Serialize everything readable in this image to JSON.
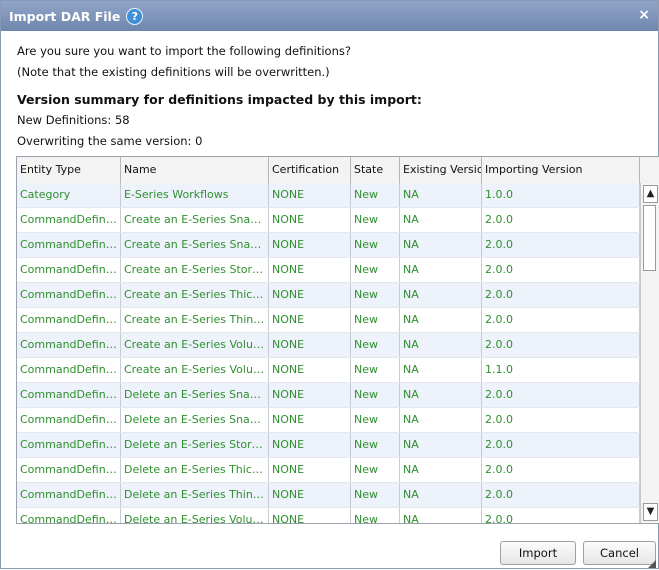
{
  "window": {
    "title": "Import DAR File"
  },
  "prompt": {
    "question": "Are you sure you want to import the following definitions?",
    "note": "(Note that the existing definitions will be overwritten.)",
    "summary_heading": "Version summary for definitions impacted by this import:",
    "new_definitions": "New Definitions: 58",
    "overwriting": "Overwriting the same version: 0"
  },
  "table": {
    "columns": [
      "Entity Type",
      "Name",
      "Certification",
      "State",
      "Existing Version",
      "Importing Version"
    ],
    "rows": [
      [
        "Category",
        "E-Series Workflows",
        "NONE",
        "New",
        "NA",
        "1.0.0"
      ],
      [
        "CommandDefinition",
        "Create an E-Series Snapshot",
        "NONE",
        "New",
        "NA",
        "2.0.0"
      ],
      [
        "CommandDefinition",
        "Create an E-Series Snaps...",
        "NONE",
        "New",
        "NA",
        "2.0.0"
      ],
      [
        "CommandDefinition",
        "Create an E-Series Storag...",
        "NONE",
        "New",
        "NA",
        "2.0.0"
      ],
      [
        "CommandDefinition",
        "Create an E-Series Thick V...",
        "NONE",
        "New",
        "NA",
        "2.0.0"
      ],
      [
        "CommandDefinition",
        "Create an E-Series Thin V...",
        "NONE",
        "New",
        "NA",
        "2.0.0"
      ],
      [
        "CommandDefinition",
        "Create an E-Series Volume...",
        "NONE",
        "New",
        "NA",
        "2.0.0"
      ],
      [
        "CommandDefinition",
        "Create an E-Series Volume...",
        "NONE",
        "New",
        "NA",
        "1.1.0"
      ],
      [
        "CommandDefinition",
        "Delete an E-Series Snapshot",
        "NONE",
        "New",
        "NA",
        "2.0.0"
      ],
      [
        "CommandDefinition",
        "Delete an E-Series Snapsh...",
        "NONE",
        "New",
        "NA",
        "2.0.0"
      ],
      [
        "CommandDefinition",
        "Delete an E-Series Storag...",
        "NONE",
        "New",
        "NA",
        "2.0.0"
      ],
      [
        "CommandDefinition",
        "Delete an E-Series Thick V...",
        "NONE",
        "New",
        "NA",
        "2.0.0"
      ],
      [
        "CommandDefinition",
        "Delete an E-Series Thin Vo...",
        "NONE",
        "New",
        "NA",
        "2.0.0"
      ],
      [
        "CommandDefinition",
        "Delete an E-Series Volume...",
        "NONE",
        "New",
        "NA",
        "2.0.0"
      ]
    ]
  },
  "buttons": {
    "import": "Import",
    "cancel": "Cancel"
  },
  "icons": {
    "help": "help-icon",
    "close": "close-icon",
    "scroll_up": "scroll-up-arrow-icon",
    "scroll_down": "scroll-down-arrow-icon"
  },
  "colors": {
    "titlebar": "#7c92b8",
    "row_text": "#2f8f2f",
    "row_alt": "#eef2fb"
  }
}
